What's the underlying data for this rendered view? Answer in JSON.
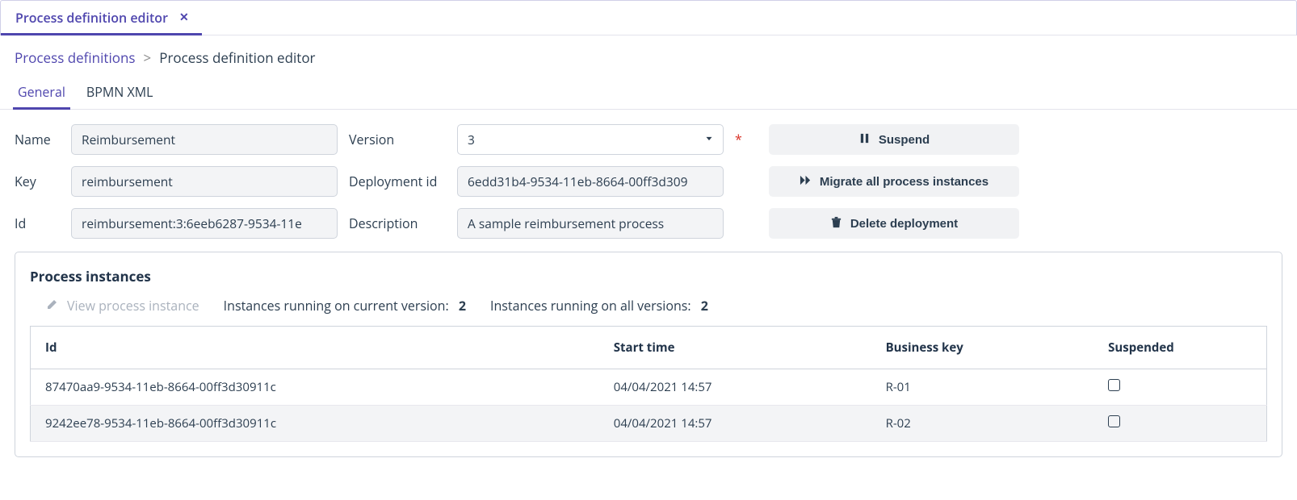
{
  "tabbar": {
    "tabs": [
      {
        "label": "Process definition editor",
        "closable": true,
        "active": true
      }
    ]
  },
  "breadcrumb": {
    "items": [
      {
        "label": "Process definitions",
        "link": true
      },
      {
        "label": "Process definition editor",
        "link": false
      }
    ],
    "sep": ">"
  },
  "subtabs": [
    {
      "label": "General",
      "active": true
    },
    {
      "label": "BPMN XML",
      "active": false
    }
  ],
  "form": {
    "name_label": "Name",
    "name_value": "Reimbursement",
    "key_label": "Key",
    "key_value": "reimbursement",
    "id_label": "Id",
    "id_value": "reimbursement:3:6eeb6287-9534-11e",
    "version_label": "Version",
    "version_value": "3",
    "version_required": true,
    "deployment_id_label": "Deployment id",
    "deployment_id_value": "6edd31b4-9534-11eb-8664-00ff3d309",
    "description_label": "Description",
    "description_value": "A sample reimbursement process"
  },
  "actions": {
    "suspend": "Suspend",
    "migrate": "Migrate all process instances",
    "delete": "Delete deployment"
  },
  "instances_panel": {
    "title": "Process instances",
    "view_link": "View process instance",
    "running_current_label": "Instances running on current version:",
    "running_current_value": "2",
    "running_all_label": "Instances running on all versions:",
    "running_all_value": "2",
    "columns": {
      "id": "Id",
      "start": "Start time",
      "bkey": "Business key",
      "suspended": "Suspended"
    },
    "rows": [
      {
        "id": "87470aa9-9534-11eb-8664-00ff3d30911c",
        "start": "04/04/2021 14:57",
        "bkey": "R-01",
        "suspended": false
      },
      {
        "id": "9242ee78-9534-11eb-8664-00ff3d30911c",
        "start": "04/04/2021 14:57",
        "bkey": "R-02",
        "suspended": false
      }
    ]
  }
}
